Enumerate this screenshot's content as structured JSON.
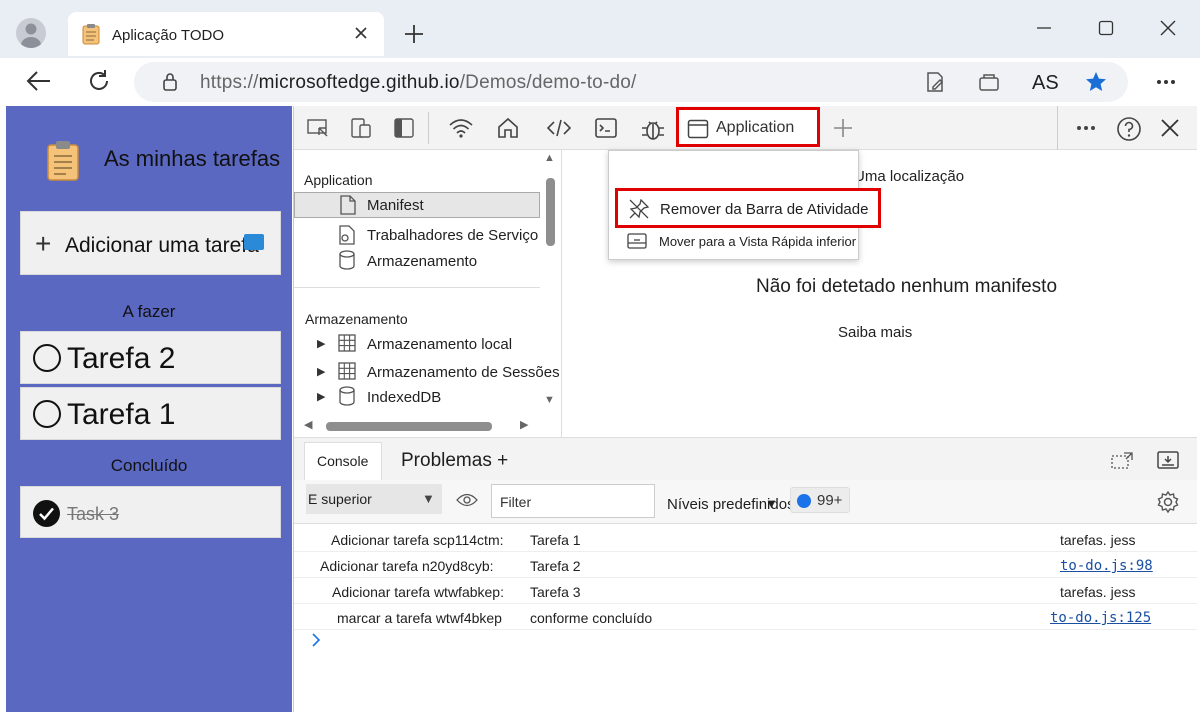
{
  "browser": {
    "tab_title": "Aplicação TODO",
    "url": {
      "protocol": "https://",
      "host": "microsoftedge.github.io",
      "path": "/Demos/demo-to-do/"
    },
    "profile_label": "AS",
    "icons": [
      "profile-icon",
      "notepad-icon",
      "close-icon",
      "new-tab-icon",
      "minimize-icon",
      "maximize-icon",
      "back-icon",
      "refresh-icon",
      "lock-icon",
      "edit-icon",
      "collections-icon",
      "favorite-star-icon",
      "more-icon"
    ]
  },
  "app": {
    "title": "As minhas tarefas",
    "add_task_label": "Adicionar uma tarefa",
    "todo_heading": "A fazer",
    "todo_tasks": [
      "Tarefa 2",
      "Tarefa 1"
    ],
    "done_heading": "Concluído",
    "done_tasks": [
      "Task 3"
    ],
    "background_color": "#5a68c2"
  },
  "devtools": {
    "active_tab": "Application",
    "sidebar": {
      "app_section": "Application",
      "app_items": [
        "Manifest",
        "Trabalhadores de Serviço",
        "Armazenamento"
      ],
      "storage_section": "Armazenamento",
      "storage_items": [
        "Armazenamento local",
        "Armazenamento de Sessões",
        "IndexedDB"
      ]
    },
    "context_menu": {
      "item1": "Remover da Barra de Atividade",
      "item2": "Mover para a Vista Rápida inferior"
    },
    "main": {
      "location_hint": "Uma localização",
      "no_manifest": "Não foi detetado nenhum manifesto",
      "learn_more": "Saiba mais"
    },
    "drawer": {
      "tab_console": "Console",
      "tab_issues": "Problemas +"
    },
    "console_toolbar": {
      "context": "E superior",
      "filter_placeholder": "Filter",
      "levels": "Níveis predefinidos",
      "issue_count": "99+"
    },
    "logs": [
      {
        "message": "Adicionar tarefa scp114ctm:",
        "value": "Tarefa 1",
        "source": "tarefas. jess",
        "is_link": false
      },
      {
        "message": "Adicionar tarefa n20yd8cyb:",
        "value": "Tarefa 2",
        "source": "to-do.js:98",
        "is_link": true
      },
      {
        "message": "Adicionar tarefa wtwfabkep:",
        "value": "Tarefa 3",
        "source": "tarefas. jess",
        "is_link": false
      },
      {
        "message": "marcar a tarefa wtwf4bkep",
        "value": "conforme concluído",
        "source": "to-do.js:125",
        "is_link": true
      }
    ],
    "highlight_color": "#e00000"
  }
}
